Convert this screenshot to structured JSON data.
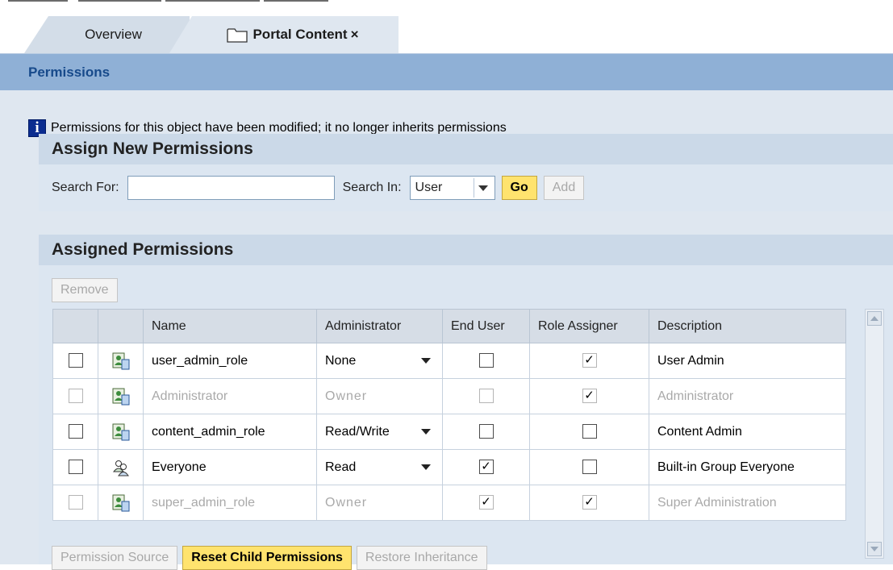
{
  "tabs": [
    {
      "label": "Overview"
    },
    {
      "label": "Portal Content",
      "close_icon": "close-icon"
    }
  ],
  "page": {
    "title": "Permissions"
  },
  "info": {
    "message": "Permissions for this object have been modified; it no longer inherits permissions",
    "icon": "info-icon"
  },
  "assign": {
    "header": "Assign New Permissions",
    "search_for_label": "Search For:",
    "search_for_value": "",
    "search_in_label": "Search In:",
    "search_in_selected": "User",
    "go_label": "Go",
    "add_label": "Add"
  },
  "assigned": {
    "header": "Assigned Permissions",
    "remove_label": "Remove",
    "columns": [
      "",
      "",
      "Name",
      "Administrator",
      "End User",
      "Role Assigner",
      "Description"
    ],
    "rows": [
      {
        "name": "user_admin_role",
        "admin": "None",
        "admin_dropdown": true,
        "end_user": false,
        "end_user_disabled": false,
        "role_assigner": true,
        "role_assigner_disabled": true,
        "description": "User Admin",
        "disabled": false,
        "icon": "role-icon"
      },
      {
        "name": "Administrator",
        "admin": "Owner",
        "admin_dropdown": false,
        "end_user": false,
        "end_user_disabled": true,
        "role_assigner": true,
        "role_assigner_disabled": true,
        "description": "Administrator",
        "disabled": true,
        "icon": "role-icon"
      },
      {
        "name": "content_admin_role",
        "admin": "Read/Write",
        "admin_dropdown": true,
        "end_user": false,
        "end_user_disabled": false,
        "role_assigner": false,
        "role_assigner_disabled": false,
        "description": "Content Admin",
        "disabled": false,
        "icon": "role-icon"
      },
      {
        "name": "Everyone",
        "admin": "Read",
        "admin_dropdown": true,
        "end_user": true,
        "end_user_disabled": false,
        "role_assigner": false,
        "role_assigner_disabled": false,
        "description": "Built-in Group Everyone",
        "disabled": false,
        "icon": "group-icon"
      },
      {
        "name": "super_admin_role",
        "admin": "Owner",
        "admin_dropdown": false,
        "end_user": true,
        "end_user_disabled": true,
        "role_assigner": true,
        "role_assigner_disabled": true,
        "description": "Super Administration",
        "disabled": true,
        "icon": "role-icon"
      }
    ]
  },
  "bottom_buttons": {
    "permission_source": "Permission Source",
    "reset_child": "Reset Child Permissions",
    "restore_inheritance": "Restore Inheritance"
  },
  "colors": {
    "title_bar": "#8fb0d6",
    "title_text": "#174a8b",
    "panel": "#dce6f1",
    "button_highlight": "#ffe36e"
  }
}
